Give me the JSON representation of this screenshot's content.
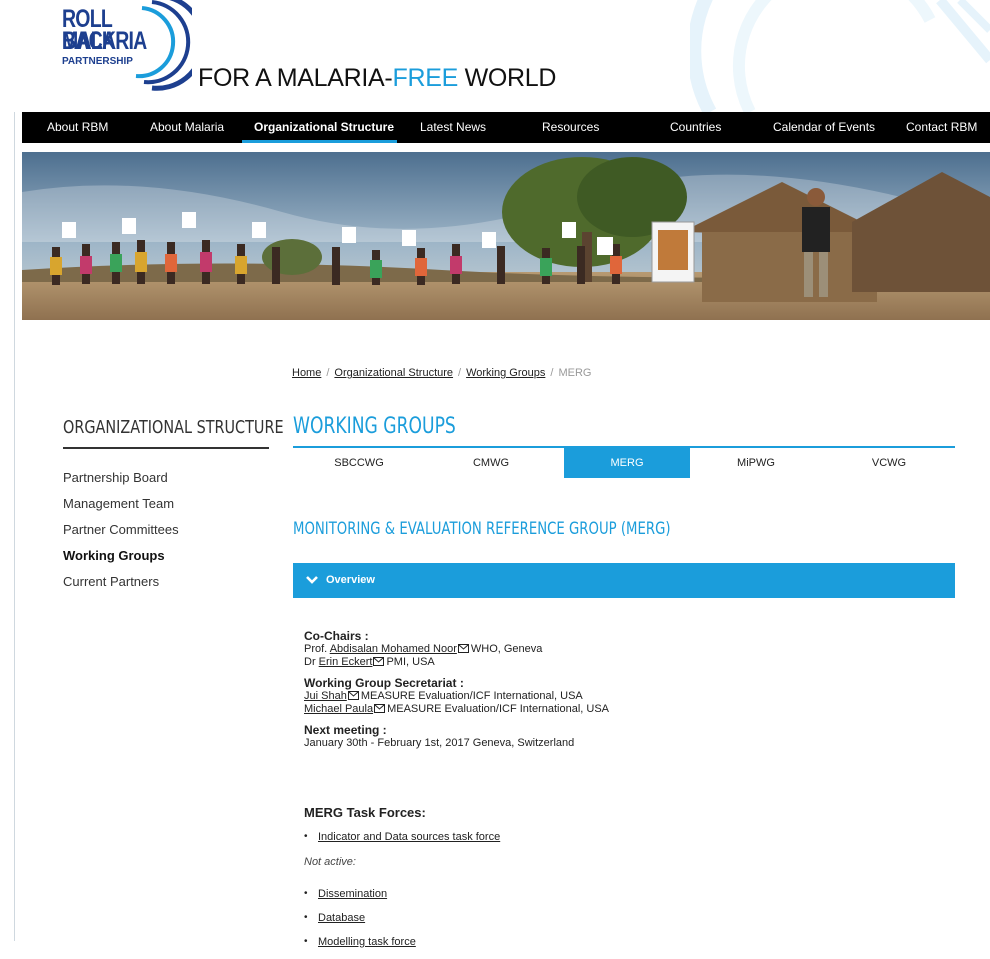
{
  "logo": {
    "line1": "ROLL BACK",
    "line2": "MALARIA",
    "line3": "PARTNERSHIP",
    "tagline_main": "FOR A MALARIA-",
    "tagline_accent": "FREE",
    "tagline_end": " WORLD"
  },
  "nav": {
    "items": [
      {
        "label": "About RBM"
      },
      {
        "label": "About Malaria"
      },
      {
        "label": "Organizational Structure"
      },
      {
        "label": "Latest News"
      },
      {
        "label": "Resources"
      },
      {
        "label": "Countries"
      },
      {
        "label": "Calendar of Events"
      },
      {
        "label": "Contact RBM"
      }
    ]
  },
  "breadcrumb": {
    "home": "Home",
    "org": "Organizational Structure",
    "wg": "Working Groups",
    "current": "MERG"
  },
  "sidebar": {
    "title": "ORGANIZATIONAL STRUCTURE",
    "items": [
      {
        "label": "Partnership Board"
      },
      {
        "label": "Management Team"
      },
      {
        "label": "Partner Committees"
      },
      {
        "label": "Working Groups"
      },
      {
        "label": "Current Partners"
      }
    ]
  },
  "main": {
    "title": "WORKING GROUPS",
    "tabs": [
      {
        "label": "SBCCWG"
      },
      {
        "label": "CMWG"
      },
      {
        "label": "MERG"
      },
      {
        "label": "MiPWG"
      },
      {
        "label": "VCWG"
      }
    ],
    "section_title": "MONITORING & EVALUATION REFERENCE GROUP (MERG)",
    "accordion_label": "Overview"
  },
  "overview": {
    "cochairs_label": "Co-Chairs :",
    "chair1_prefix": "Prof. ",
    "chair1_name": "Abdisalan Mohamed Noor",
    "chair1_org": "WHO, Geneva",
    "chair2_prefix": "Dr ",
    "chair2_name": "Erin Eckert",
    "chair2_org": "PMI, USA",
    "secretariat_label": "Working Group Secretariat :",
    "sec1_name": "Jui Shah",
    "sec1_org": "MEASURE Evaluation/ICF International, USA",
    "sec2_name": "Michael Paula",
    "sec2_org": "MEASURE Evaluation/ICF International, USA",
    "meeting_label": "Next meeting :",
    "meeting_value": "January 30th - February 1st, 2017 Geneva, Switzerland"
  },
  "taskforces": {
    "title": "MERG Task Forces:",
    "active": [
      {
        "label": "Indicator and Data sources task force"
      }
    ],
    "not_active_label": "Not active:",
    "inactive": [
      {
        "label": "Dissemination"
      },
      {
        "label": "Database"
      },
      {
        "label": "Modelling task force"
      }
    ]
  },
  "colors": {
    "accent": "#1b9ddb",
    "logo": "#1d3f8f",
    "nav_bg": "#000000"
  }
}
